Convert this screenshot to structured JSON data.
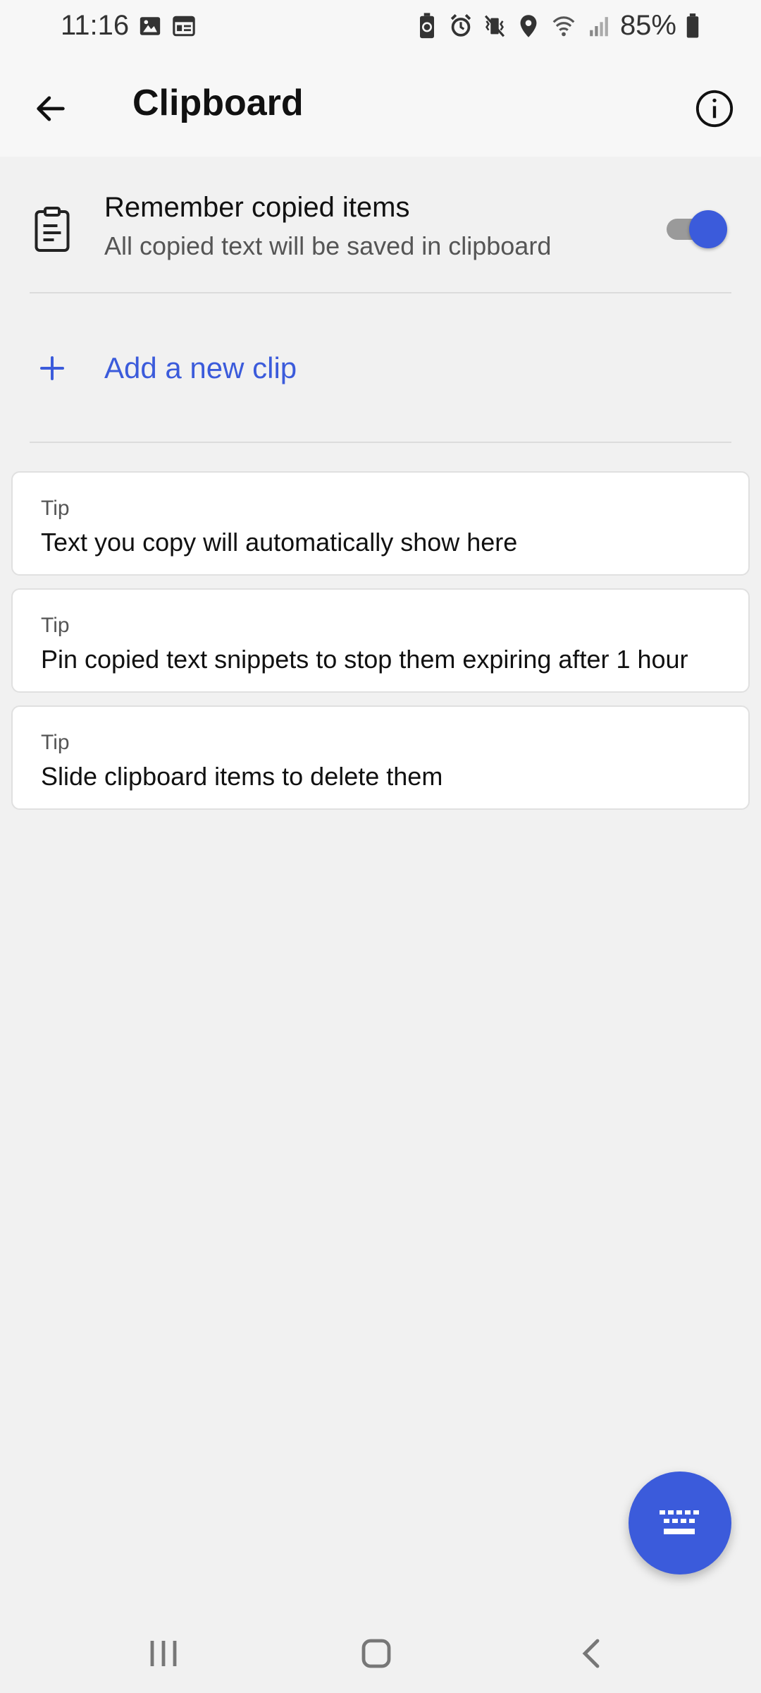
{
  "status_bar": {
    "time": "11:16",
    "battery": "85%"
  },
  "app_bar": {
    "title": "Clipboard"
  },
  "settings": {
    "remember": {
      "title": "Remember copied items",
      "subtitle": "All copied text will be saved in clipboard",
      "enabled": true
    },
    "add_clip_label": "Add a new clip"
  },
  "tips": [
    {
      "label": "Tip",
      "text": "Text you copy will automatically show here"
    },
    {
      "label": "Tip",
      "text": "Pin copied text snippets to stop them expiring after 1 hour"
    },
    {
      "label": "Tip",
      "text": "Slide clipboard items to delete them"
    }
  ],
  "icons": {
    "back": "arrow-left-icon",
    "info": "info-icon",
    "clipboard": "clipboard-icon",
    "add": "plus-icon",
    "keyboard": "keyboard-icon"
  },
  "colors": {
    "accent": "#3b5bdb",
    "background": "#f1f1f1",
    "card": "#ffffff"
  }
}
